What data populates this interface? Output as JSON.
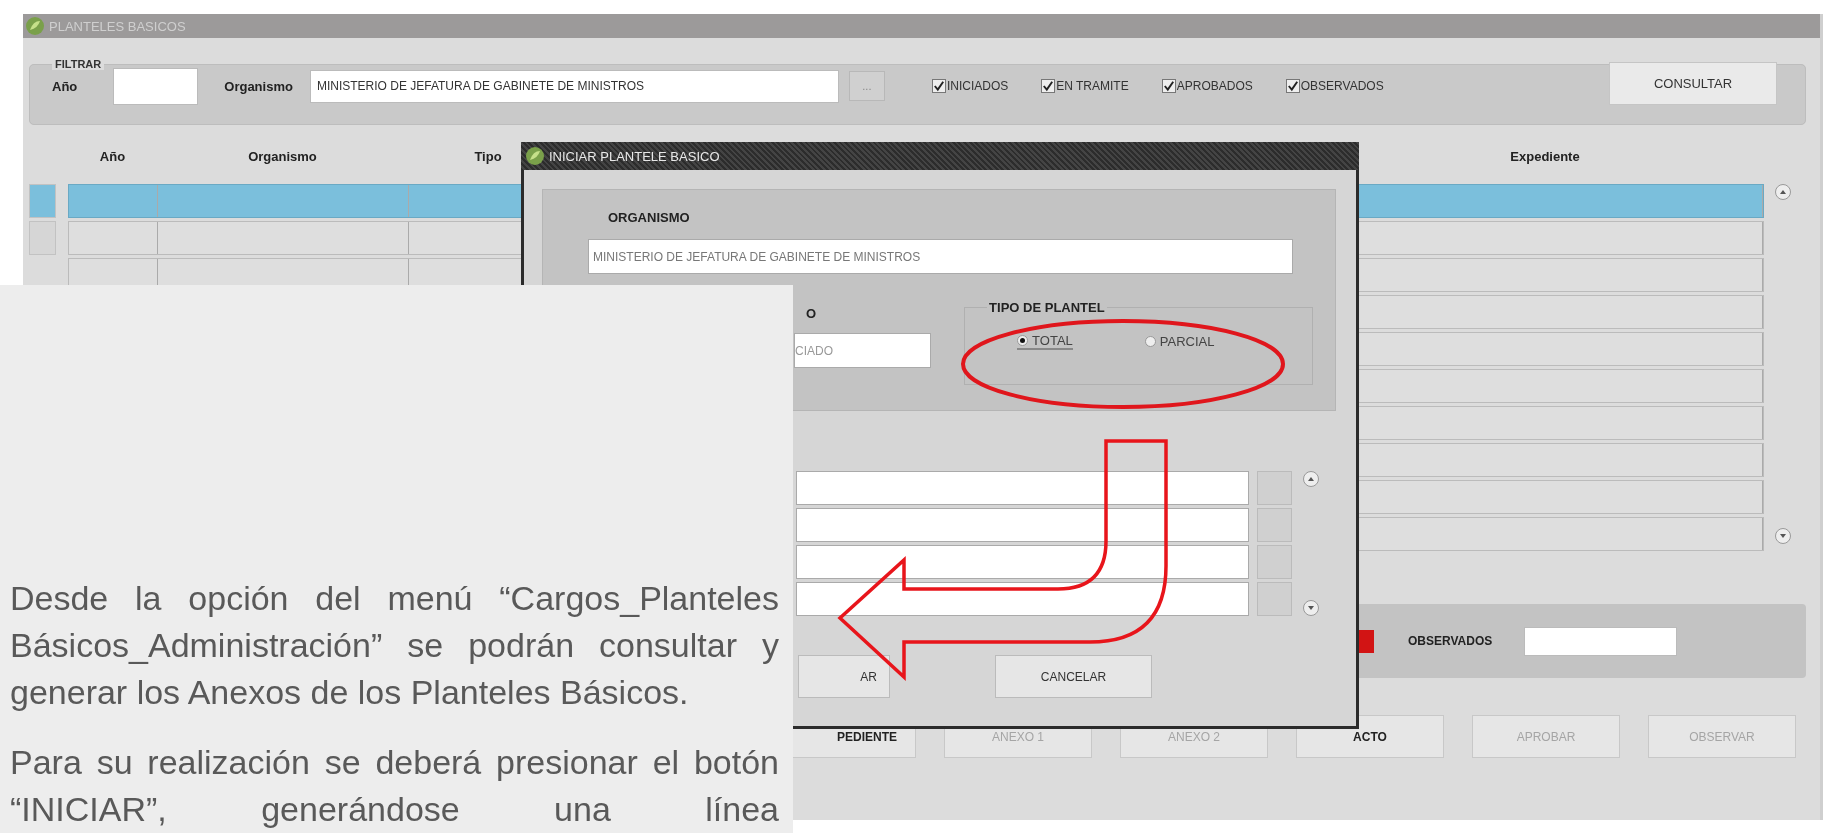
{
  "window": {
    "title": "PLANTELES BASICOS"
  },
  "filter": {
    "legend": "FILTRAR",
    "year_label": "Año",
    "organism_label": "Organismo",
    "organism_value": "MINISTERIO DE JEFATURA DE GABINETE DE MINISTROS",
    "browse_button": "...",
    "checkboxes": [
      {
        "label": "INICIADOS",
        "checked": true
      },
      {
        "label": "EN TRAMITE",
        "checked": true
      },
      {
        "label": "APROBADOS",
        "checked": true
      },
      {
        "label": "OBSERVADOS",
        "checked": true
      }
    ],
    "consult_button": "CONSULTAR"
  },
  "table": {
    "columns": [
      "Año",
      "Organismo",
      "Tipo",
      "",
      "Expediente"
    ],
    "rows": [
      {
        "selected": true
      },
      {
        "selected": false
      },
      {
        "selected": false
      },
      {
        "selected": false
      },
      {
        "selected": false
      },
      {
        "selected": false
      },
      {
        "selected": false
      },
      {
        "selected": false
      },
      {
        "selected": false
      },
      {
        "selected": false
      }
    ]
  },
  "counters": {
    "observados_label": "OBSERVADOS"
  },
  "buttons": [
    {
      "label": "PEDIENTE",
      "disabled": false
    },
    {
      "label": "ANEXO 1",
      "disabled": true
    },
    {
      "label": "ANEXO 2",
      "disabled": true
    },
    {
      "label": "ACTO",
      "disabled": false
    },
    {
      "label": "APROBAR",
      "disabled": true
    },
    {
      "label": "OBSERVAR",
      "disabled": true
    }
  ],
  "dialog": {
    "title": "INICIAR PLANTELE BASICO",
    "organismo_label": "ORGANISMO",
    "organismo_value": "MINISTERIO DE JEFATURA DE GABINETE DE MINISTROS",
    "estado_label": "O",
    "estado_value": "CIADO",
    "tipo_label": "TIPO DE PLANTEL",
    "radios": [
      {
        "label": "TOTAL",
        "selected": true
      },
      {
        "label": "PARCIAL",
        "selected": false
      }
    ],
    "buttons": [
      {
        "label": "AR"
      },
      {
        "label": "CANCELAR"
      }
    ]
  },
  "note": {
    "paragraphs": [
      "Desde la opción del menú “Cargos_Planteles Básicos_Administración” se podrán consultar y generar los Anexos de los Planteles Básicos.",
      "Para su realización se deberá presionar el botón “INICIAR”, generándose una línea"
    ]
  }
}
